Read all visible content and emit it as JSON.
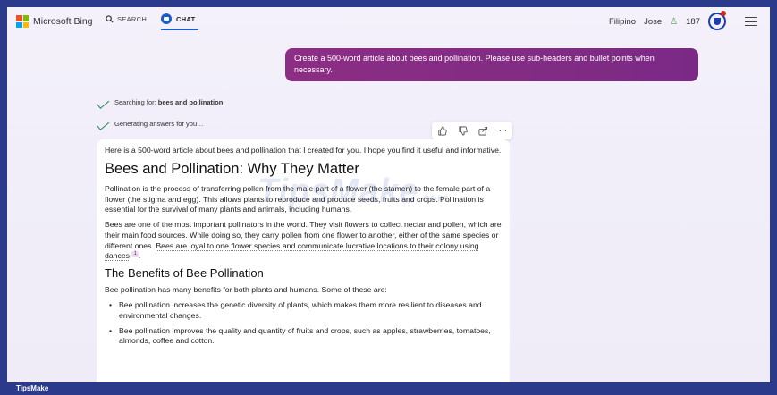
{
  "header": {
    "brand": "Microsoft Bing",
    "brand_colors": [
      "#f25022",
      "#7fba00",
      "#00a4ef",
      "#ffb900"
    ],
    "search_tab": "SEARCH",
    "chat_tab": "CHAT",
    "language": "Filipino",
    "user_name": "Jose",
    "rewards_points": "187"
  },
  "user_message": "Create a 500-word article about bees and pollination. Please use sub-headers and bullet points when necessary.",
  "status": {
    "searching_prefix": "Searching for: ",
    "searching_term": "bees and pollination",
    "generating": "Generating answers for you…"
  },
  "actions": {
    "like_icon": "thumbs-up-icon",
    "dislike_icon": "thumbs-down-icon",
    "share_icon": "share-icon",
    "more_icon": "more-icon"
  },
  "answer": {
    "intro": "Here is a 500-word article about bees and pollination that I created for you. I hope you find it useful and informative.",
    "title": "Bees and Pollination: Why They Matter",
    "para1": "Pollination is the process of transferring pollen from the male part of a flower (the stamen) to the female part of a flower (the stigma and egg). This allows plants to reproduce and produce seeds, fruits and crops. Pollination is essential for the survival of many plants and animals, including humans.",
    "para2_main": "Bees are one of the most important pollinators in the world. They visit flowers to collect nectar and pollen, which are their main food sources. While doing so, they carry pollen from one flower to another, either of the same species or different ones. ",
    "para2_cited": "Bees are loyal to one flower species and communicate lucrative locations to their colony using dances",
    "para2_cite_num": "1",
    "para2_end": ".",
    "subheading": "The Benefits of Bee Pollination",
    "benefits_intro": "Bee pollination has many benefits for both plants and humans. Some of these are:",
    "bullets": [
      "Bee pollination increases the genetic diversity of plants, which makes them more resilient to diseases and environmental changes.",
      "Bee pollination improves the quality and quantity of fruits and crops, such as apples, strawberries, tomatoes, almonds, coffee and cotton."
    ]
  },
  "watermark": {
    "text": "TipsMake",
    "suffix": ".com"
  },
  "footer": {
    "label": "TipsMake"
  }
}
